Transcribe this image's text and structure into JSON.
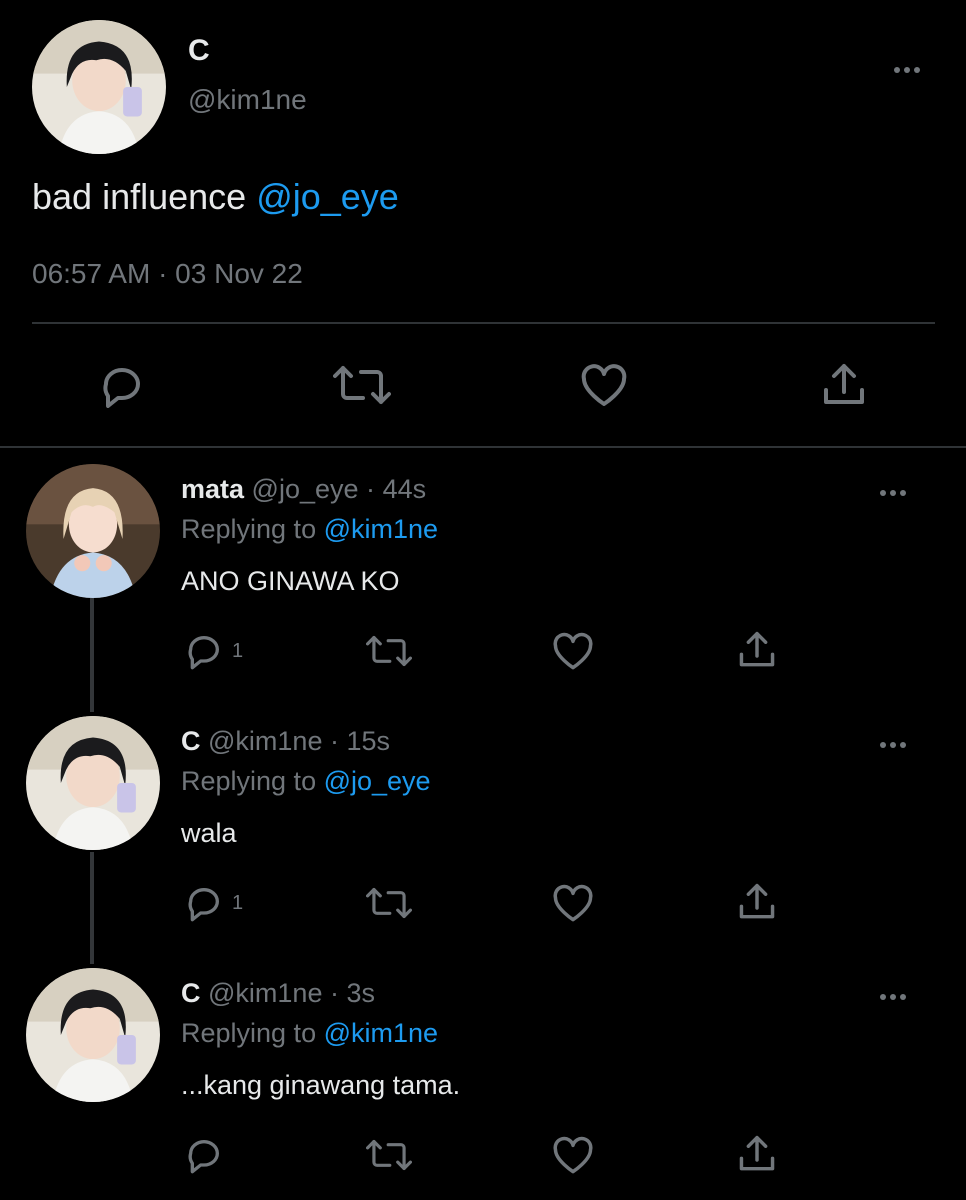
{
  "main_tweet": {
    "display_name": "C",
    "handle": "@kim1ne",
    "text_plain": "bad influence ",
    "text_mention": "@jo_eye",
    "timestamp": "06:57 AM · 03 Nov 22"
  },
  "replies": [
    {
      "display_name": "mata",
      "handle": "@jo_eye",
      "dot": "·",
      "age": "44s",
      "replying_label": "Replying to ",
      "replying_to": "@kim1ne",
      "text": "ANO GINAWA KO",
      "reply_count": "1"
    },
    {
      "display_name": "C",
      "handle": "@kim1ne",
      "dot": "·",
      "age": "15s",
      "replying_label": "Replying to ",
      "replying_to": "@jo_eye",
      "text": "wala",
      "reply_count": "1"
    },
    {
      "display_name": "C",
      "handle": "@kim1ne",
      "dot": "·",
      "age": "3s",
      "replying_label": "Replying to ",
      "replying_to": "@kim1ne",
      "text": "...kang ginawang tama.",
      "reply_count": ""
    }
  ],
  "icons": {
    "reply": "reply-icon",
    "retweet": "retweet-icon",
    "like": "heart-icon",
    "share": "share-icon",
    "more": "more-icon"
  },
  "colors": {
    "background": "#000000",
    "text": "#e7e9ea",
    "muted": "#71767b",
    "accent": "#1d9bf0",
    "divider": "#2f3336"
  }
}
